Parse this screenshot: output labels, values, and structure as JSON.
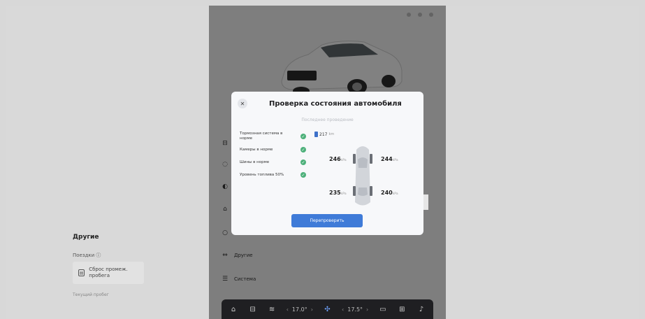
{
  "status_icons": [
    "dot-icon",
    "dot-icon",
    "dot-icon"
  ],
  "sidebar": {
    "items": [
      {
        "label": "Другие",
        "icon": "car-icon"
      },
      {
        "label": "Система",
        "icon": "sliders-icon"
      }
    ]
  },
  "main": {
    "section_title": "Другие",
    "trips_label": "Поездки ⓘ",
    "reset_card": "Сброс промеж. пробега",
    "current_mileage": "Текущий пробег"
  },
  "modal": {
    "title": "Проверка состояния автомобиля",
    "subtitle": "Последнее проведение",
    "close_icon": "close-icon",
    "checks": [
      {
        "label": "Тормозная система в норме",
        "status": "ok"
      },
      {
        "label": "Камеры в норме",
        "status": "ok"
      },
      {
        "label": "Шины в норме",
        "status": "ok"
      },
      {
        "label": "Уровень топлива 50%",
        "status": "ok"
      }
    ],
    "range_value": "217",
    "range_unit": "km",
    "tires": {
      "front_left": {
        "value": "246",
        "unit": "kPa"
      },
      "front_right": {
        "value": "244",
        "unit": "kPa"
      },
      "rear_left": {
        "value": "235",
        "unit": "kPa"
      },
      "rear_right": {
        "value": "240",
        "unit": "kPa"
      }
    },
    "recheck_button": "Перепроверить"
  },
  "dock": {
    "temp_left": "17.0°",
    "temp_right": "17.5°",
    "icons": [
      "home-icon",
      "car-icon",
      "heat-icon",
      "fan-icon",
      "defrost-icon",
      "apps-icon",
      "music-icon"
    ]
  },
  "colors": {
    "accent": "#3f7bd8",
    "ok_green": "#4db07a",
    "dock_bg": "#1f1f22"
  }
}
